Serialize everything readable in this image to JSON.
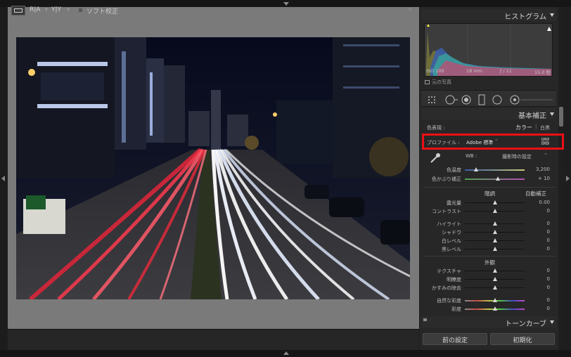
{
  "panel": {
    "histogram": {
      "title": "ヒストグラム",
      "iso": "ISO 100",
      "focal": "18 mm",
      "aperture": "ƒ / 11",
      "shutter": "15.0 秒",
      "original_photo": "元の写真"
    },
    "basic": {
      "title": "基本補正",
      "treatment_label": "色表現 :",
      "treatment_color": "カラー",
      "treatment_bw": "白黒",
      "profile_label": "プロファイル :",
      "profile_value": "Adobe 標準",
      "wb_label": "WB :",
      "wb_value": "撮影時の設定",
      "temp_label": "色温度",
      "temp_value": "3,200",
      "tint_label": "色かぶり補正",
      "tint_value": "+ 10",
      "tone_label": "階調",
      "auto_label": "自動補正",
      "exposure_label": "露光量",
      "exposure_value": "0.00",
      "contrast_label": "コントラスト",
      "contrast_value": "0",
      "highlights_label": "ハイライト",
      "highlights_value": "0",
      "shadows_label": "シャドウ",
      "shadows_value": "0",
      "whites_label": "白レベル",
      "whites_value": "0",
      "blacks_label": "黒レベル",
      "blacks_value": "0",
      "presence_label": "外観",
      "texture_label": "テクスチャ",
      "texture_value": "0",
      "clarity_label": "明瞭度",
      "clarity_value": "0",
      "dehaze_label": "かすみの除去",
      "dehaze_value": "0",
      "vibrance_label": "自然な彩度",
      "vibrance_value": "0",
      "saturation_label": "彩度",
      "saturation_value": "0"
    },
    "tone_curve": {
      "title": "トーンカーブ"
    },
    "buttons": {
      "previous": "前の設定",
      "reset": "初期化"
    }
  },
  "toolbar": {
    "compare_ra": "R|A",
    "compare_yy": "Y|Y",
    "soft_proof": "ソフト校正"
  },
  "colors": {
    "highlight_box": "#ec0f16",
    "panel_bg": "#272727",
    "canvas_bg": "#7a7a7a"
  }
}
